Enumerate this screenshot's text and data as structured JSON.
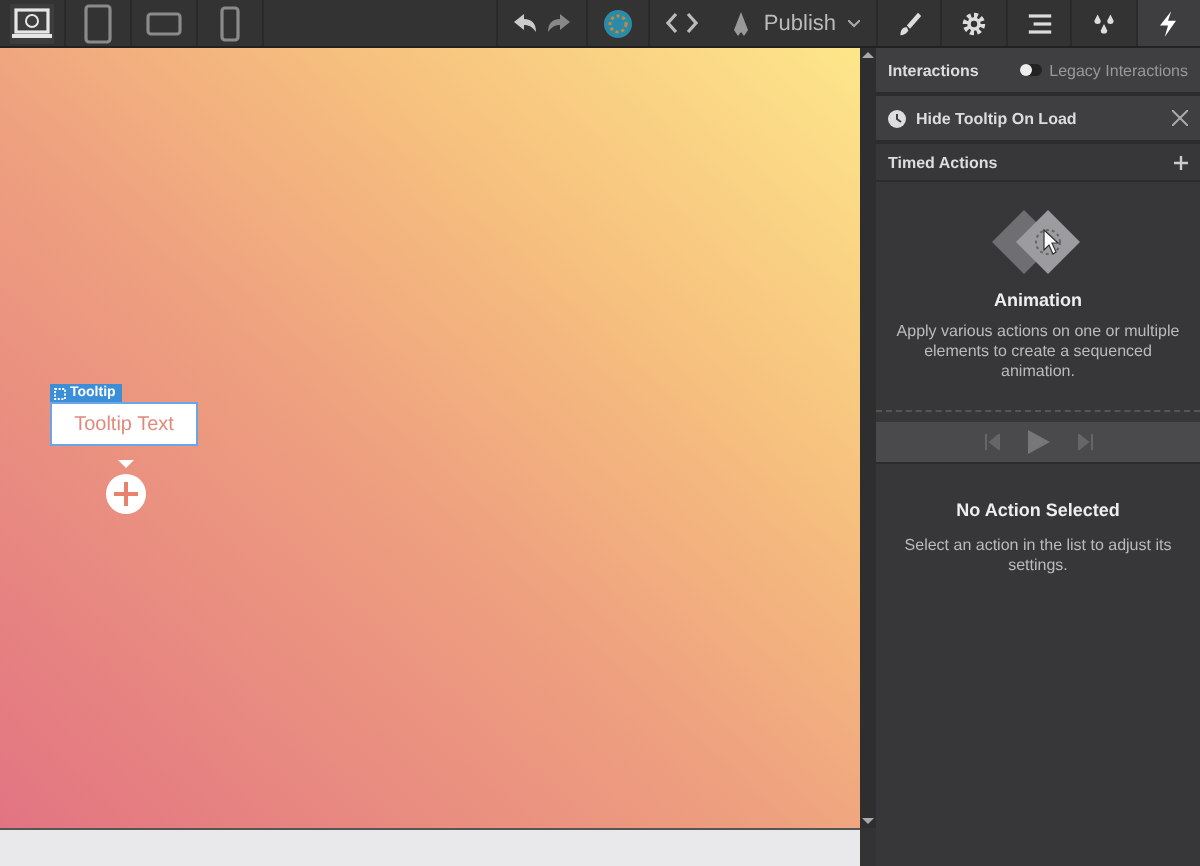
{
  "devices": [
    {
      "kind": "desktop",
      "selected": true
    },
    {
      "kind": "tablet",
      "selected": false
    },
    {
      "kind": "landscape",
      "selected": false
    },
    {
      "kind": "phone",
      "selected": false
    }
  ],
  "toolbar": {
    "publish": "Publish"
  },
  "panel_tabs": [
    {
      "kind": "brush",
      "selected": false
    },
    {
      "kind": "gear",
      "selected": false
    },
    {
      "kind": "navigator",
      "selected": false
    },
    {
      "kind": "drops",
      "selected": false
    },
    {
      "kind": "bolt",
      "selected": true
    }
  ],
  "canvas": {
    "element_label": "Tooltip",
    "tooltip_text": "Tooltip Text"
  },
  "interactions": {
    "title": "Interactions",
    "legacy_label": "Legacy Interactions",
    "legacy_on": false
  },
  "trigger": {
    "title": "Hide Tooltip On Load"
  },
  "timed_actions": {
    "title": "Timed Actions"
  },
  "empty_state": {
    "title": "Animation",
    "description": "Apply various actions on one or multiple elements to create a sequenced animation."
  },
  "detail": {
    "title": "No Action Selected",
    "description": "Select an action in the list to adjust its settings."
  }
}
